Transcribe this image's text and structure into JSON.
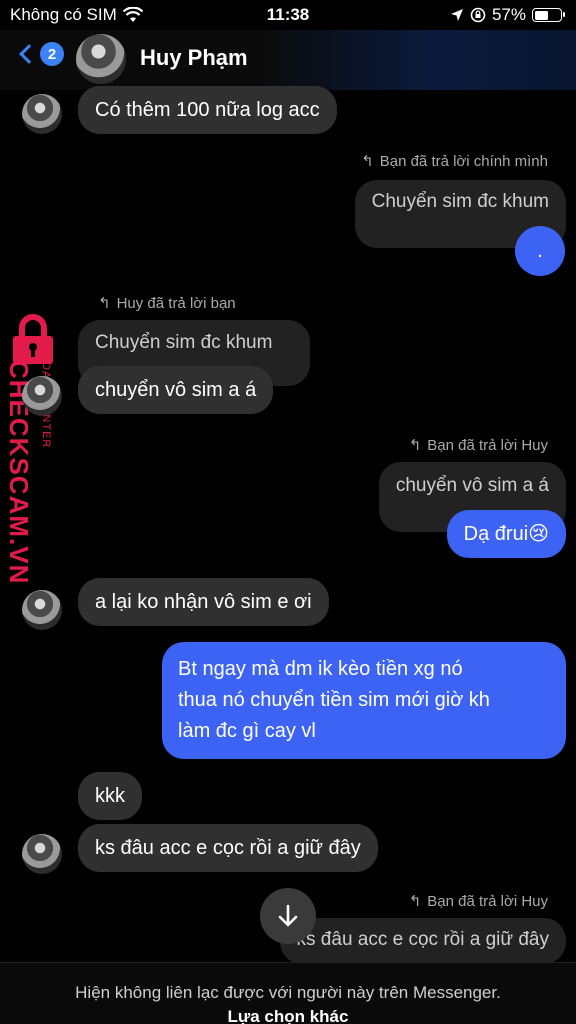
{
  "status_bar": {
    "carrier": "Không có SIM",
    "time": "11:38",
    "battery": "57%",
    "battery_level": 0.57
  },
  "header": {
    "back_count": "2",
    "contact_name": "Huy Phạm"
  },
  "messages": {
    "m1": "Có thêm 100 nữa log acc",
    "r1_note": "Bạn đã trả lời chính mình",
    "r1_quote": "Chuyển sim đc khum",
    "r1_text": ".",
    "r2_note": "Huy đã trả lời bạn",
    "r2_quote": "Chuyển sim đc khum",
    "r2_text": "chuyển vô sim a á",
    "r3_note": "Bạn đã trả lời Huy",
    "r3_quote": "chuyển vô sim a á",
    "r3_text": "Dạ đrui😢",
    "m2": "a lại ko nhận vô sim e ơi",
    "m3_line1": "Bt ngay mà dm ik kèo tiền xg nó",
    "m3_line2": "thua nó chuyển tiền sim mới giờ kh",
    "m3_line3": "làm đc gì cay vl",
    "m4": "kkk",
    "m5": "ks đâu acc e cọc rồi a giữ đây",
    "r4_note": "Bạn đã trả lời Huy",
    "r4_quote": "ks đâu acc e cọc rồi a giữ đây"
  },
  "watermark": {
    "brand": "CHECKSCAM.VN",
    "sub": "DATA CENTER"
  },
  "footer": {
    "info": "Hiện không liên lạc được với người này trên Messenger.",
    "alt_action": "Lựa chọn khác"
  },
  "icons": {
    "wifi": "wifi-icon",
    "location": "location-icon",
    "lock_rotation": "lock-rotation-icon",
    "reply": "reply-arrow-icon",
    "down": "arrow-down-icon",
    "back": "chevron-left-icon"
  },
  "colors": {
    "outgoing": "#3d63f5",
    "incoming": "#303030",
    "accent": "#3b82f6",
    "watermark": "#e31b4b"
  }
}
